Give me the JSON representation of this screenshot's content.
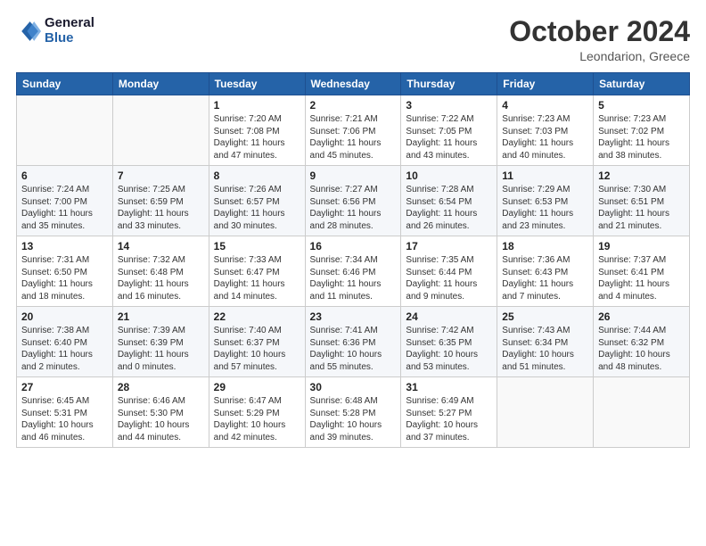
{
  "header": {
    "logo_line1": "General",
    "logo_line2": "Blue",
    "month_title": "October 2024",
    "location": "Leondarion, Greece"
  },
  "days_of_week": [
    "Sunday",
    "Monday",
    "Tuesday",
    "Wednesday",
    "Thursday",
    "Friday",
    "Saturday"
  ],
  "weeks": [
    [
      {
        "day": "",
        "info": ""
      },
      {
        "day": "",
        "info": ""
      },
      {
        "day": "1",
        "info": "Sunrise: 7:20 AM\nSunset: 7:08 PM\nDaylight: 11 hours and 47 minutes."
      },
      {
        "day": "2",
        "info": "Sunrise: 7:21 AM\nSunset: 7:06 PM\nDaylight: 11 hours and 45 minutes."
      },
      {
        "day": "3",
        "info": "Sunrise: 7:22 AM\nSunset: 7:05 PM\nDaylight: 11 hours and 43 minutes."
      },
      {
        "day": "4",
        "info": "Sunrise: 7:23 AM\nSunset: 7:03 PM\nDaylight: 11 hours and 40 minutes."
      },
      {
        "day": "5",
        "info": "Sunrise: 7:23 AM\nSunset: 7:02 PM\nDaylight: 11 hours and 38 minutes."
      }
    ],
    [
      {
        "day": "6",
        "info": "Sunrise: 7:24 AM\nSunset: 7:00 PM\nDaylight: 11 hours and 35 minutes."
      },
      {
        "day": "7",
        "info": "Sunrise: 7:25 AM\nSunset: 6:59 PM\nDaylight: 11 hours and 33 minutes."
      },
      {
        "day": "8",
        "info": "Sunrise: 7:26 AM\nSunset: 6:57 PM\nDaylight: 11 hours and 30 minutes."
      },
      {
        "day": "9",
        "info": "Sunrise: 7:27 AM\nSunset: 6:56 PM\nDaylight: 11 hours and 28 minutes."
      },
      {
        "day": "10",
        "info": "Sunrise: 7:28 AM\nSunset: 6:54 PM\nDaylight: 11 hours and 26 minutes."
      },
      {
        "day": "11",
        "info": "Sunrise: 7:29 AM\nSunset: 6:53 PM\nDaylight: 11 hours and 23 minutes."
      },
      {
        "day": "12",
        "info": "Sunrise: 7:30 AM\nSunset: 6:51 PM\nDaylight: 11 hours and 21 minutes."
      }
    ],
    [
      {
        "day": "13",
        "info": "Sunrise: 7:31 AM\nSunset: 6:50 PM\nDaylight: 11 hours and 18 minutes."
      },
      {
        "day": "14",
        "info": "Sunrise: 7:32 AM\nSunset: 6:48 PM\nDaylight: 11 hours and 16 minutes."
      },
      {
        "day": "15",
        "info": "Sunrise: 7:33 AM\nSunset: 6:47 PM\nDaylight: 11 hours and 14 minutes."
      },
      {
        "day": "16",
        "info": "Sunrise: 7:34 AM\nSunset: 6:46 PM\nDaylight: 11 hours and 11 minutes."
      },
      {
        "day": "17",
        "info": "Sunrise: 7:35 AM\nSunset: 6:44 PM\nDaylight: 11 hours and 9 minutes."
      },
      {
        "day": "18",
        "info": "Sunrise: 7:36 AM\nSunset: 6:43 PM\nDaylight: 11 hours and 7 minutes."
      },
      {
        "day": "19",
        "info": "Sunrise: 7:37 AM\nSunset: 6:41 PM\nDaylight: 11 hours and 4 minutes."
      }
    ],
    [
      {
        "day": "20",
        "info": "Sunrise: 7:38 AM\nSunset: 6:40 PM\nDaylight: 11 hours and 2 minutes."
      },
      {
        "day": "21",
        "info": "Sunrise: 7:39 AM\nSunset: 6:39 PM\nDaylight: 11 hours and 0 minutes."
      },
      {
        "day": "22",
        "info": "Sunrise: 7:40 AM\nSunset: 6:37 PM\nDaylight: 10 hours and 57 minutes."
      },
      {
        "day": "23",
        "info": "Sunrise: 7:41 AM\nSunset: 6:36 PM\nDaylight: 10 hours and 55 minutes."
      },
      {
        "day": "24",
        "info": "Sunrise: 7:42 AM\nSunset: 6:35 PM\nDaylight: 10 hours and 53 minutes."
      },
      {
        "day": "25",
        "info": "Sunrise: 7:43 AM\nSunset: 6:34 PM\nDaylight: 10 hours and 51 minutes."
      },
      {
        "day": "26",
        "info": "Sunrise: 7:44 AM\nSunset: 6:32 PM\nDaylight: 10 hours and 48 minutes."
      }
    ],
    [
      {
        "day": "27",
        "info": "Sunrise: 6:45 AM\nSunset: 5:31 PM\nDaylight: 10 hours and 46 minutes."
      },
      {
        "day": "28",
        "info": "Sunrise: 6:46 AM\nSunset: 5:30 PM\nDaylight: 10 hours and 44 minutes."
      },
      {
        "day": "29",
        "info": "Sunrise: 6:47 AM\nSunset: 5:29 PM\nDaylight: 10 hours and 42 minutes."
      },
      {
        "day": "30",
        "info": "Sunrise: 6:48 AM\nSunset: 5:28 PM\nDaylight: 10 hours and 39 minutes."
      },
      {
        "day": "31",
        "info": "Sunrise: 6:49 AM\nSunset: 5:27 PM\nDaylight: 10 hours and 37 minutes."
      },
      {
        "day": "",
        "info": ""
      },
      {
        "day": "",
        "info": ""
      }
    ]
  ]
}
